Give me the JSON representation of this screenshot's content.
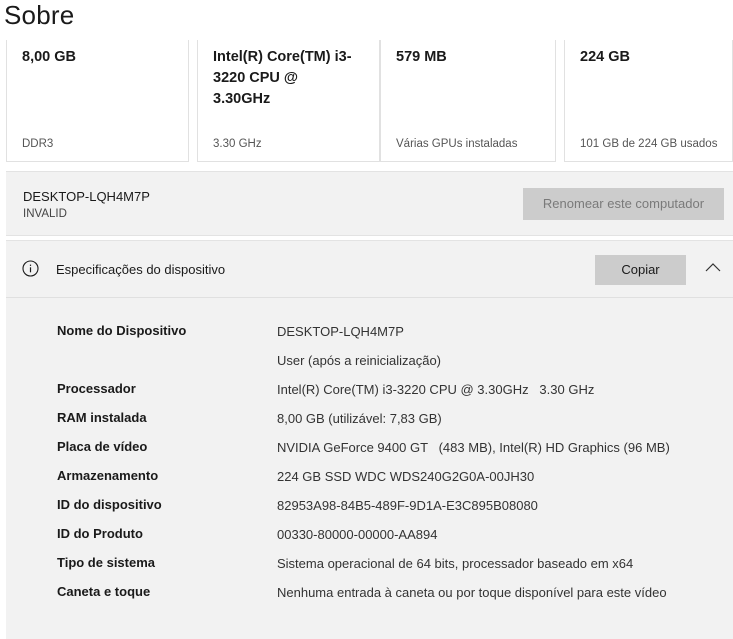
{
  "page": {
    "title": "Sobre"
  },
  "cards": [
    {
      "value": "8,00 GB",
      "sub": "DDR3"
    },
    {
      "value": "Intel(R) Core(TM) i3-3220 CPU @ 3.30GHz",
      "sub": "3.30 GHz"
    },
    {
      "value": "579 MB",
      "sub": "Várias GPUs instaladas"
    },
    {
      "value": "224 GB",
      "sub": "101 GB de 224 GB usados"
    }
  ],
  "pc": {
    "name": "DESKTOP-LQH4M7P",
    "sub": "INVALID",
    "rename_label": "Renomear este computador"
  },
  "specs": {
    "title": "Especificações do dispositivo",
    "copy_label": "Copiar",
    "rows": [
      {
        "label": "Nome do Dispositivo",
        "value": "DESKTOP-LQH4M7P"
      },
      {
        "label": "",
        "value": "User (após a reinicialização)"
      },
      {
        "label": "Processador",
        "value": "Intel(R) Core(TM) i3-3220 CPU @ 3.30GHz   3.30 GHz"
      },
      {
        "label": "RAM instalada",
        "value": "8,00 GB (utilizável: 7,83 GB)"
      },
      {
        "label": "Placa de vídeo",
        "value": "NVIDIA GeForce 9400 GT   (483 MB), Intel(R) HD Graphics (96 MB)"
      },
      {
        "label": "Armazenamento",
        "value": "224 GB SSD WDC WDS240G2G0A-00JH30"
      },
      {
        "label": "ID do dispositivo",
        "value": "82953A98-84B5-489F-9D1A-E3C895B08080"
      },
      {
        "label": "ID do Produto",
        "value": "00330-80000-00000-AA894"
      },
      {
        "label": "Tipo de sistema",
        "value": "Sistema operacional de 64 bits, processador baseado em x64"
      },
      {
        "label": "Caneta e toque",
        "value": "Nenhuma entrada à caneta ou por toque disponível para este vídeo"
      }
    ]
  }
}
